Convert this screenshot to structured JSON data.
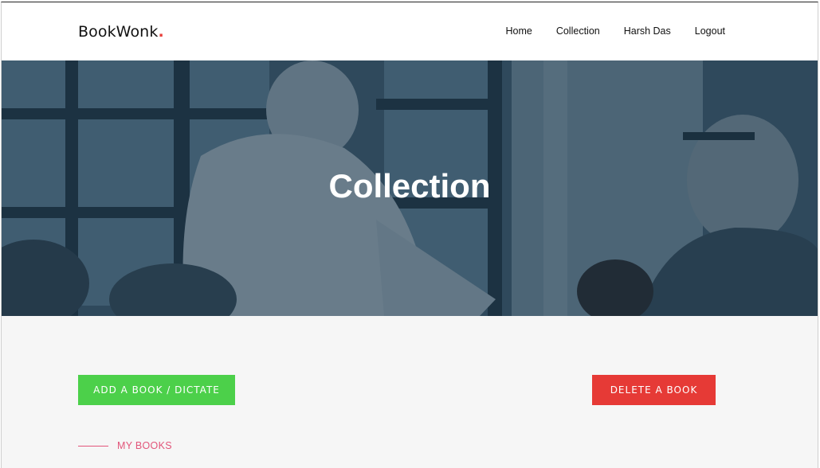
{
  "brand": {
    "name": "BookWonk",
    "dot": "."
  },
  "nav": {
    "items": [
      {
        "label": "Home"
      },
      {
        "label": "Collection"
      },
      {
        "label": "Harsh Das"
      },
      {
        "label": "Logout"
      }
    ]
  },
  "hero": {
    "title": "Collection"
  },
  "actions": {
    "add_label": "ADD A BOOK / DICTATE",
    "delete_label": "DELETE A BOOK"
  },
  "section": {
    "label": "MY BOOKS"
  },
  "colors": {
    "add_button": "#4cd04a",
    "delete_button": "#e63a36",
    "accent": "#e2557a",
    "brand_dot": "#e8413c"
  }
}
